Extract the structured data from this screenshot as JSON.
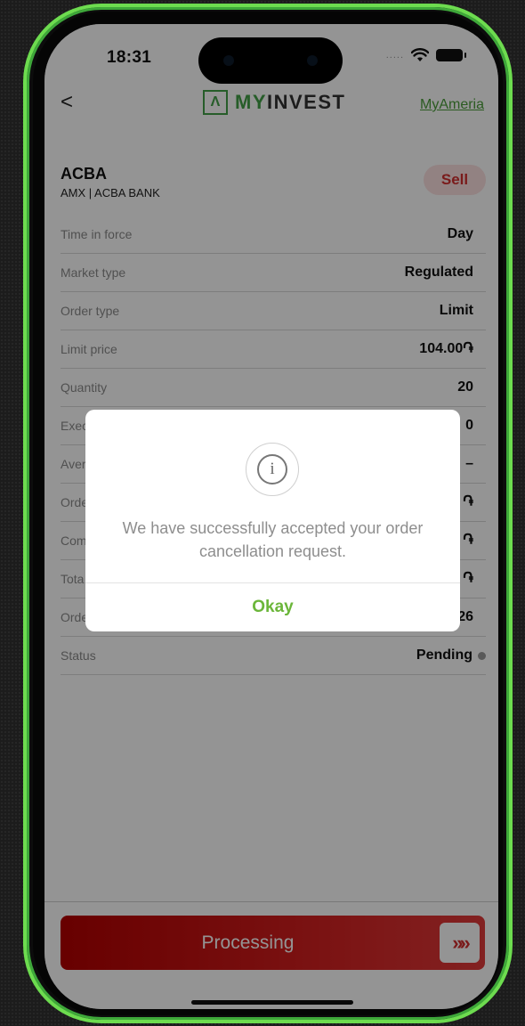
{
  "status_bar": {
    "time": "18:31",
    "signal": "....."
  },
  "nav": {
    "back_icon": "<",
    "logo_mark": "Λ",
    "logo_prefix": "MY",
    "logo_suffix": "INVEST",
    "myameria_link": "MyAmeria"
  },
  "order": {
    "ticker": "ACBA",
    "subtitle": "AMX | ACBA BANK",
    "side": "Sell",
    "rows": [
      {
        "label": "Time in force",
        "value": "Day"
      },
      {
        "label": "Market type",
        "value": "Regulated"
      },
      {
        "label": "Order type",
        "value": "Limit"
      },
      {
        "label": "Limit price",
        "value": "104.00֏"
      },
      {
        "label": "Quantity",
        "value": "20"
      },
      {
        "label": "Exec",
        "value": "0"
      },
      {
        "label": "Aver",
        "value": "–"
      },
      {
        "label": "Orde",
        "value": "֏"
      },
      {
        "label": "Com",
        "value": "֏"
      },
      {
        "label": "Tota",
        "value": "֏"
      },
      {
        "label": "Orde",
        "value": "26"
      },
      {
        "label": "Status",
        "value": "Pending"
      }
    ]
  },
  "footer": {
    "processing_label": "Processing",
    "arrows": "»»"
  },
  "dialog": {
    "message": "We have successfully accepted your order cancellation request.",
    "ok_label": "Okay",
    "icon": "info-icon",
    "icon_glyph": "i"
  },
  "colors": {
    "accent_green": "#6bb63a",
    "sell_red": "#d32f2f",
    "processing_red": "#c0151a",
    "frame_green": "#6ddc4f"
  }
}
